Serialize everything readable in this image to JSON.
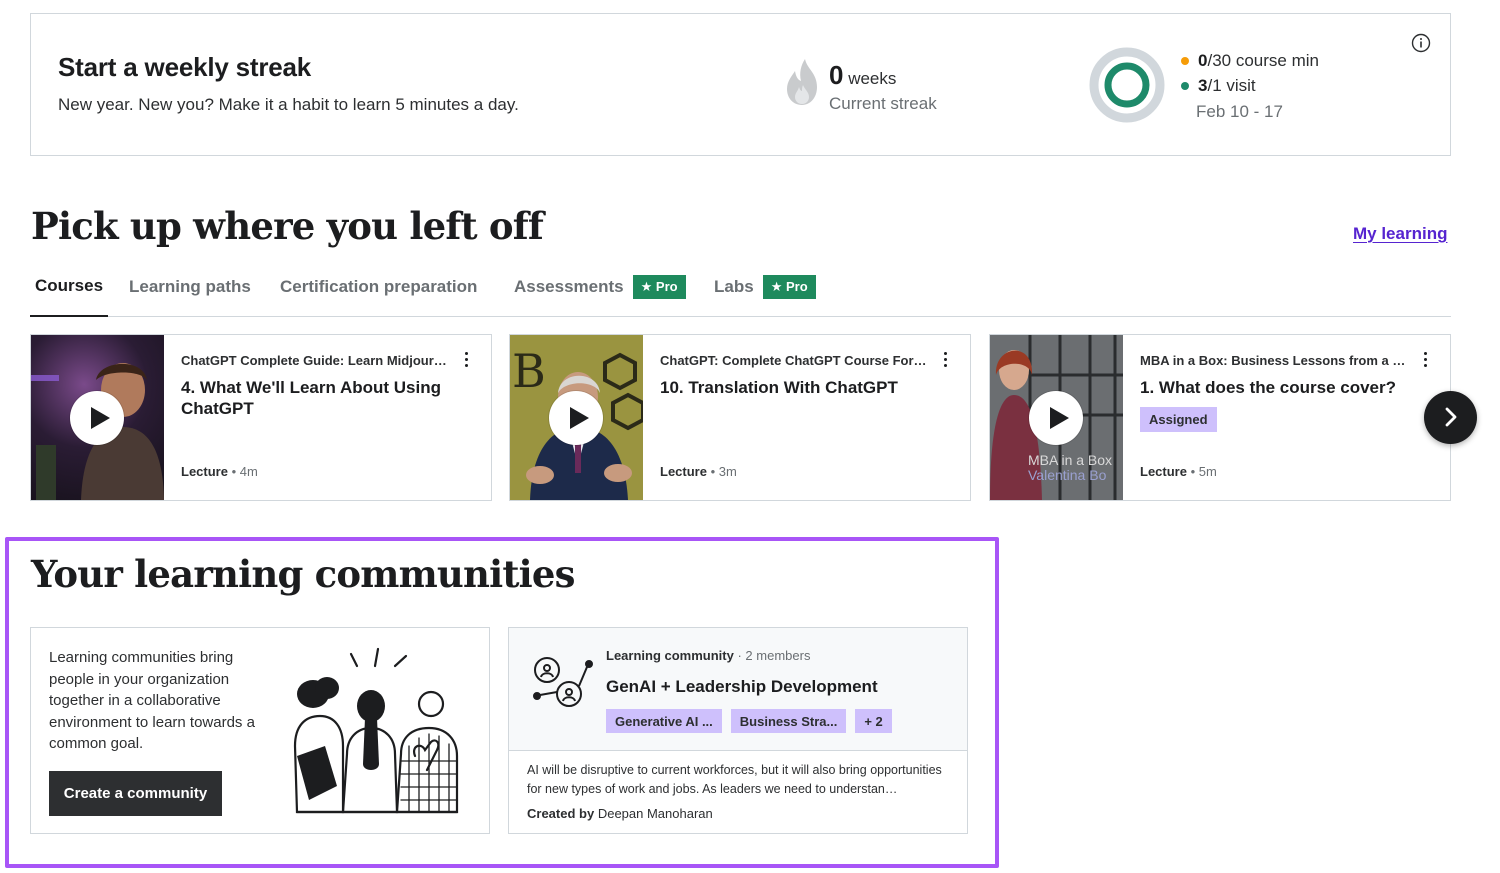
{
  "streak": {
    "title": "Start a weekly streak",
    "subtitle": "New year. New you? Make it a habit to learn 5 minutes a day.",
    "weeks_count": "0",
    "weeks_label": "weeks",
    "current_label": "Current streak",
    "minutes_value": "0",
    "minutes_rest": "/30 course min",
    "visits_value": "3",
    "visits_rest": "/1 visit",
    "date_range": "Feb 10 - 17",
    "minutes_progress": 0,
    "visits_progress": 1,
    "colors": {
      "minutes": "#f69c08",
      "visits": "#1e8a6a"
    }
  },
  "pickup": {
    "heading": "Pick up where you left off",
    "my_learning_link": "My learning",
    "tabs": [
      {
        "label": "Courses",
        "active": true
      },
      {
        "label": "Learning paths"
      },
      {
        "label": "Certification preparation"
      },
      {
        "label": "Assessments",
        "badge": "Pro"
      },
      {
        "label": "Labs",
        "badge": "Pro"
      }
    ],
    "cards": [
      {
        "course": "ChatGPT Complete Guide: Learn Midjour…",
        "title": "4. What We'll Learn About Using ChatGPT",
        "type": "Lecture",
        "duration": "4m"
      },
      {
        "course": "ChatGPT: Complete ChatGPT Course For…",
        "title": "10. Translation With ChatGPT",
        "type": "Lecture",
        "duration": "3m"
      },
      {
        "course": "MBA in a Box: Business Lessons from a …",
        "title": "1. What does the course cover?",
        "badge": "Assigned",
        "type": "Lecture",
        "duration": "5m",
        "thumb_text": [
          "MBA in a Box",
          "Valentina Bo"
        ]
      }
    ]
  },
  "communities": {
    "heading": "Your learning communities",
    "intro": "Learning communities bring people in your organization together in a collaborative environment to learn towards a common goal.",
    "create_button": "Create a community",
    "group": {
      "label": "Learning community",
      "members": "· 2 members",
      "name": "GenAI + Leadership Development",
      "tags": [
        "Generative AI ...",
        "Business Stra...",
        "+ 2"
      ],
      "description": "AI will be disruptive to current workforces, but it will also bring opportu­nities for new types of work and jobs. As leaders we need to understan…",
      "created_by_label": "Created by",
      "created_by_name": "Deepan Manoharan"
    }
  }
}
